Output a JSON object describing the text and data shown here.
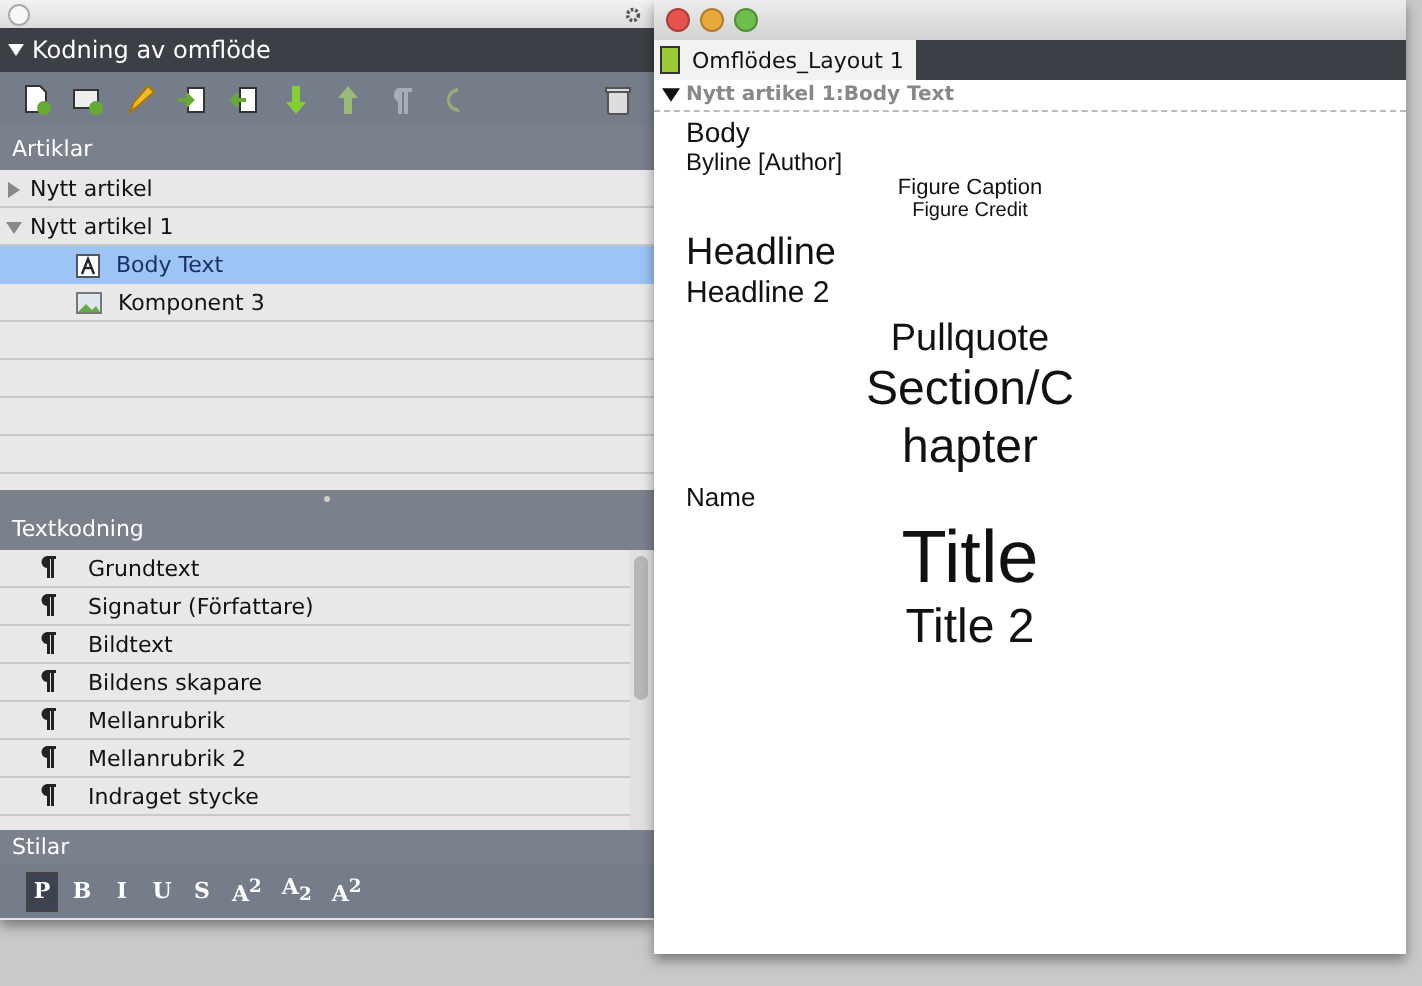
{
  "panel": {
    "title": "Kodning av omflöde",
    "expanded": true,
    "toolbar": [
      {
        "kind": "add-page"
      },
      {
        "kind": "add-image"
      },
      {
        "kind": "pencil"
      },
      {
        "kind": "import"
      },
      {
        "kind": "export"
      },
      {
        "kind": "arrow-down"
      },
      {
        "kind": "arrow-up"
      },
      {
        "kind": "pilcrow"
      },
      {
        "kind": "undo"
      },
      {
        "kind": "trash"
      }
    ],
    "articles_header": "Artiklar",
    "tree": [
      {
        "label": "Nytt artikel",
        "expanded": false,
        "selected": false
      },
      {
        "label": "Nytt artikel 1",
        "expanded": true,
        "selected": false,
        "children": [
          {
            "label": "Body Text",
            "kind": "text",
            "selected": true
          },
          {
            "label": "Komponent 3",
            "kind": "image",
            "selected": false
          }
        ]
      }
    ],
    "text_header": "Textkodning",
    "text_styles": [
      "Grundtext",
      "Signatur (Författare)",
      "Bildtext",
      "Bildens skapare",
      "Mellanrubrik",
      "Mellanrubrik 2",
      "Indraget stycke"
    ],
    "styles_header": "Stilar",
    "style_buttons": [
      {
        "label": "P",
        "selected": true
      },
      {
        "label": "B",
        "selected": false
      },
      {
        "label": "I",
        "selected": false
      },
      {
        "label": "U",
        "selected": false
      },
      {
        "label": "S",
        "selected": false
      },
      {
        "label": "A$^{2}$",
        "selected": false
      },
      {
        "label": "A$_{2}$",
        "selected": false
      },
      {
        "label": "A$^{2}$",
        "selected": false
      }
    ]
  },
  "document": {
    "tab": "Omflödes_Layout 1",
    "breadcrumb": "Nytt artikel 1:Body Text",
    "lines": [
      {
        "text": "Body",
        "kind": "body"
      },
      {
        "text": "Byline [Author]",
        "kind": "byline"
      },
      {
        "text": "Figure Caption",
        "kind": "caption"
      },
      {
        "text": "Figure Credit",
        "kind": "credit"
      },
      {
        "text": "Headline",
        "kind": "headline"
      },
      {
        "text": "Headline 2",
        "kind": "headline2"
      },
      {
        "text": "Pullquote",
        "kind": "pullquote"
      },
      {
        "text": "Section/Chapter",
        "kind": "section"
      },
      {
        "text": "Name",
        "kind": "name"
      },
      {
        "text": "Title",
        "kind": "title"
      },
      {
        "text": "Title 2",
        "kind": "title2"
      }
    ]
  }
}
